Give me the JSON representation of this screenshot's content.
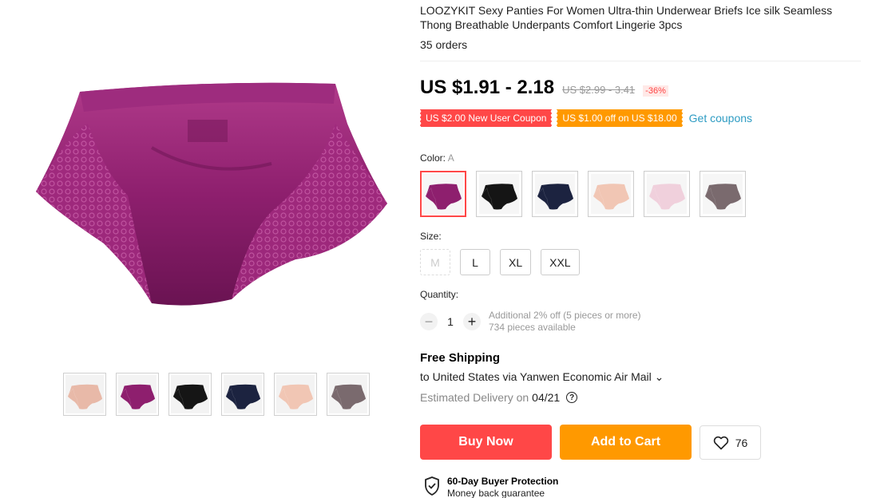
{
  "product": {
    "title": "LOOZYKIT Sexy Panties For Women Ultra-thin Underwear Briefs Ice silk Seamless Thong Breathable Underpants Comfort Lingerie 3pcs",
    "orders": "35 orders"
  },
  "price": {
    "current": "US $1.91 - 2.18",
    "original": "US $2.99 - 3.41",
    "discount": "-36%"
  },
  "coupons": {
    "new_user": "US $2.00 New User Coupon",
    "store": "US $1.00 off on US $18.00",
    "get_label": "Get coupons",
    "red_color": "#ff4747",
    "orange_color": "#ff9900"
  },
  "color": {
    "label": "Color:",
    "selected": "A",
    "swatches": [
      {
        "name": "purple",
        "hex": "#8e1f6e"
      },
      {
        "name": "black",
        "hex": "#151515"
      },
      {
        "name": "navy",
        "hex": "#1c2340"
      },
      {
        "name": "nude",
        "hex": "#f1c6b4"
      },
      {
        "name": "pink",
        "hex": "#f0d0dc"
      },
      {
        "name": "grey",
        "hex": "#7a6a6e"
      }
    ]
  },
  "size": {
    "label": "Size:",
    "options": [
      "M",
      "L",
      "XL",
      "XXL"
    ],
    "disabled": "M"
  },
  "quantity": {
    "label": "Quantity:",
    "value": "1",
    "minus": "−",
    "plus": "+",
    "note": "Additional 2% off (5 pieces or more)",
    "available": "734 pieces available"
  },
  "shipping": {
    "title": "Free Shipping",
    "to": "to United States via Yanwen Economic Air Mail",
    "chevron": "⌄",
    "est_label": "Estimated Delivery on",
    "date": "04/21",
    "help": "?"
  },
  "actions": {
    "buy_now": "Buy Now",
    "add_to_cart": "Add to Cart",
    "wishlist_count": "76"
  },
  "protection": {
    "title": "60-Day Buyer Protection",
    "subtitle": "Money back guarantee"
  },
  "gallery": {
    "main_color": "#8e1f6e",
    "thumbs": [
      {
        "name": "mixed",
        "hex": "#e8b9a8"
      },
      {
        "name": "purple",
        "hex": "#8e1f6e"
      },
      {
        "name": "black",
        "hex": "#151515"
      },
      {
        "name": "navy",
        "hex": "#1c2340"
      },
      {
        "name": "nude",
        "hex": "#f1c6b4"
      },
      {
        "name": "grey",
        "hex": "#7a6a6e"
      }
    ]
  }
}
